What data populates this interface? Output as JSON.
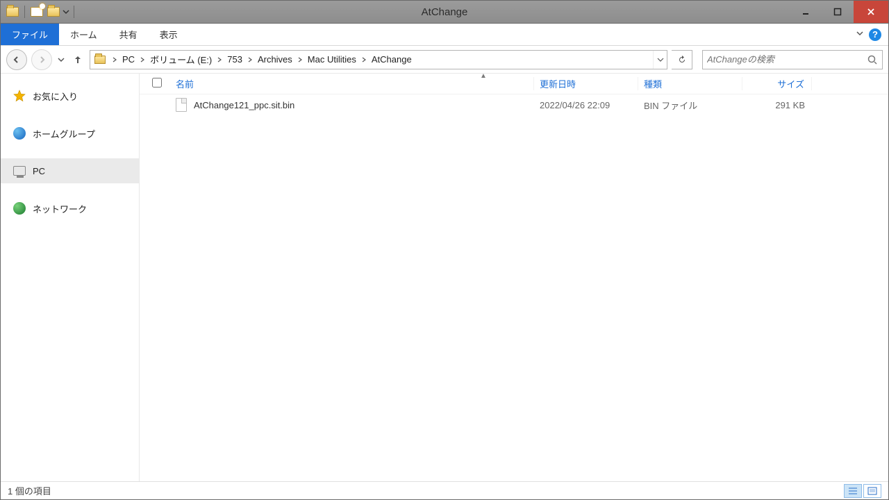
{
  "window": {
    "title": "AtChange"
  },
  "ribbon": {
    "file": "ファイル",
    "tabs": [
      "ホーム",
      "共有",
      "表示"
    ]
  },
  "breadcrumb": [
    "PC",
    "ボリューム (E:)",
    "753",
    "Archives",
    "Mac Utilities",
    "AtChange"
  ],
  "search": {
    "placeholder": "AtChangeの検索"
  },
  "sidebar": {
    "favorites": "お気に入り",
    "homegroup": "ホームグループ",
    "pc": "PC",
    "network": "ネットワーク"
  },
  "columns": {
    "name": "名前",
    "date": "更新日時",
    "type": "種類",
    "size": "サイズ"
  },
  "files": [
    {
      "name": "AtChange121_ppc.sit.bin",
      "date": "2022/04/26 22:09",
      "type": "BIN ファイル",
      "size": "291 KB"
    }
  ],
  "status": {
    "count": "1 個の項目"
  }
}
